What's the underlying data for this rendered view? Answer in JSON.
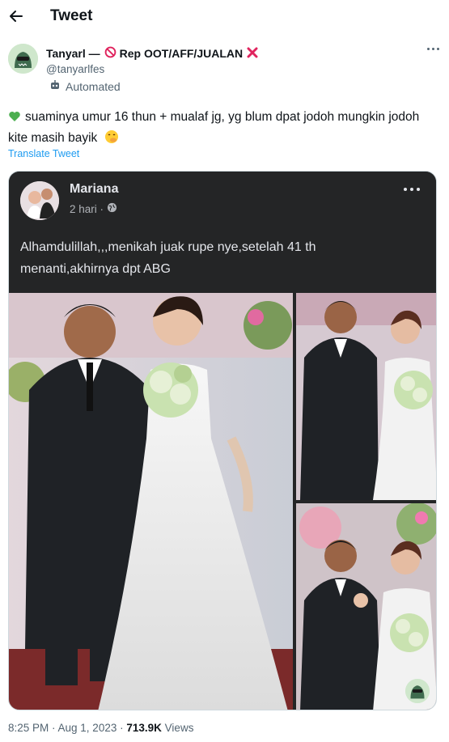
{
  "topbar": {
    "title": "Tweet"
  },
  "author": {
    "name": "Tanyarl —",
    "name_suffix": "Rep OOT/AFF/JUALAN",
    "handle": "@tanyarlfes",
    "automated_label": "Automated"
  },
  "tweet": {
    "text": "suaminya umur 16 thun + mualaf jg, yg blum dpat jodoh mungkin jodoh kite masih bayik",
    "translate_label": "Translate Tweet"
  },
  "embedded_post": {
    "name": "Mariana",
    "time": "2 hari ·",
    "text": "Alhamdulillah,,,menikah juak rupe nye,setelah 41 th menanti,akhirnya dpt ABG"
  },
  "footer": {
    "time": "8:25 PM · Aug 1, 2023 ·",
    "views_count": "713.9K",
    "views_label": "Views"
  },
  "icons": {
    "heart": "green-heart-icon",
    "emoji_end": "smiling-face-hand-over-mouth-icon",
    "prohibited": "prohibited-icon",
    "cross": "cross-mark-icon",
    "bot": "bot-icon",
    "globe": "globe-icon"
  },
  "colors": {
    "link": "#1d9bf0",
    "secondary": "#536471",
    "fb_bg": "#242526",
    "heart": "#4caf50"
  }
}
